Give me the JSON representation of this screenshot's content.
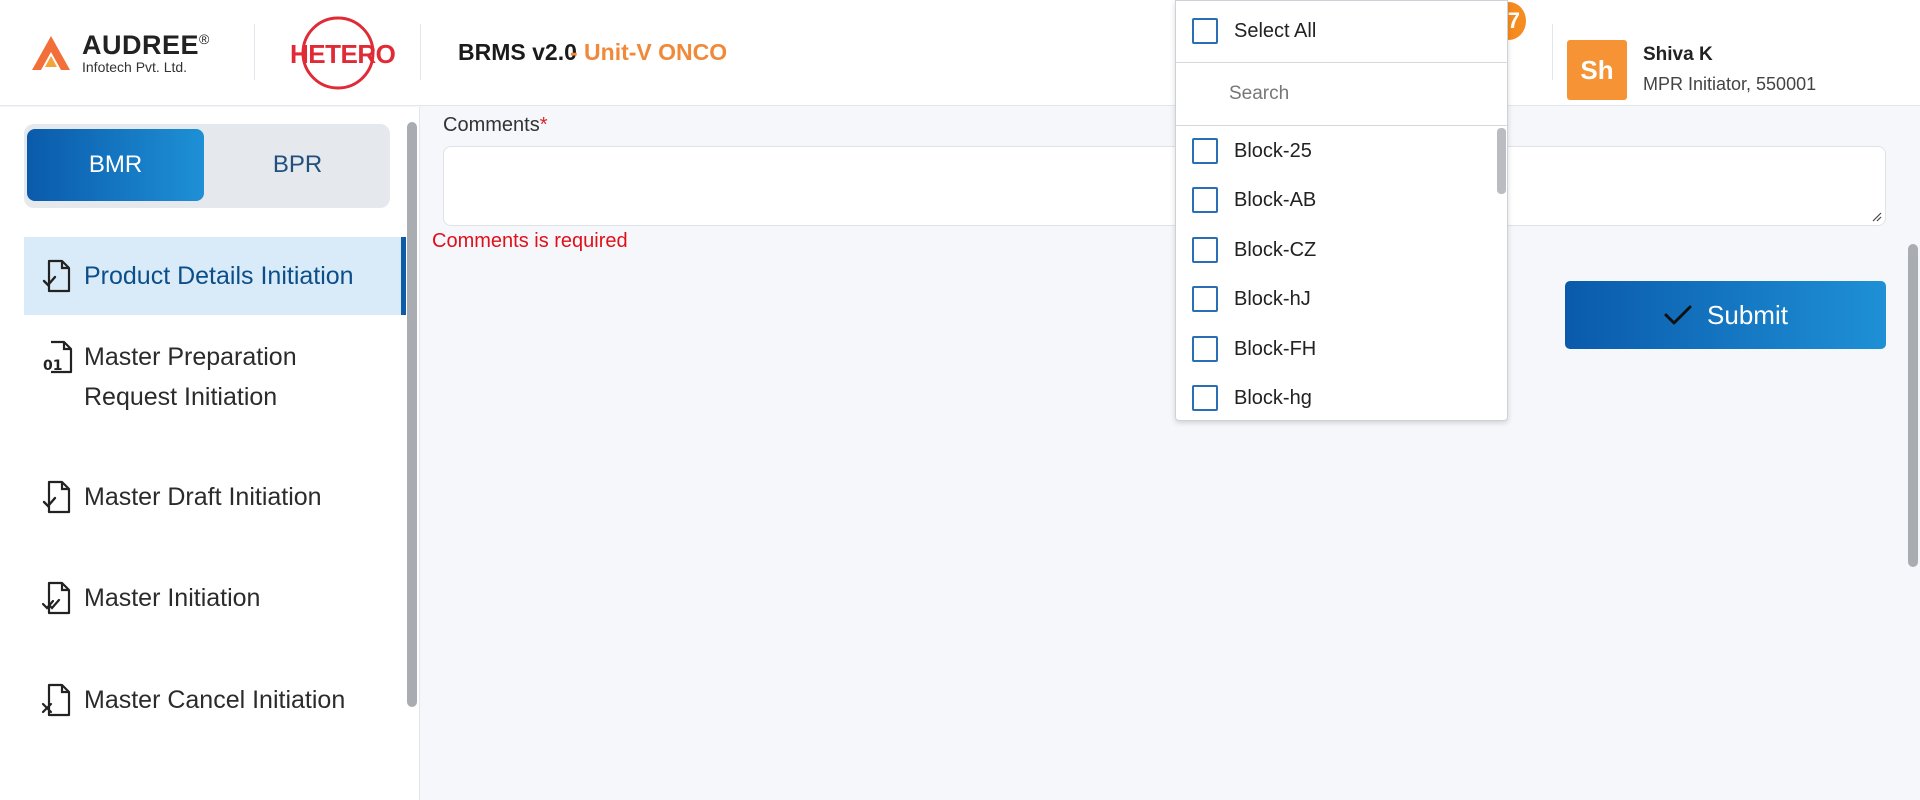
{
  "header": {
    "audree_brand": "AUDREE",
    "audree_registered": "®",
    "audree_sub": "Infotech Pvt. Ltd.",
    "hetero_brand": "HETERO",
    "app_title": "BRMS v2.0",
    "app_unit": "- Unit-V ONCO",
    "notification_count": "7",
    "user": {
      "initials": "Sh",
      "name": "Shiva K",
      "role": "MPR Initiator, 550001"
    }
  },
  "sidebar": {
    "toggle": {
      "active": "BMR",
      "inactive": "BPR"
    },
    "items": [
      {
        "label_line1": "Product Details Initiation",
        "label_line2": ""
      },
      {
        "label_line1": "Master Preparation",
        "label_line2": "Request Initiation"
      },
      {
        "label_line1": "Master Draft Initiation",
        "label_line2": ""
      },
      {
        "label_line1": "Master Initiation",
        "label_line2": ""
      },
      {
        "label_line1": "Master Cancel Initiation",
        "label_line2": ""
      }
    ]
  },
  "form": {
    "comments_label": "Comments",
    "required_marker": "*",
    "comments_value": "",
    "error": "Comments is required",
    "submit_label": "Submit"
  },
  "dropdown": {
    "select_all": "Select All",
    "search_placeholder": "Search",
    "options": [
      "Block-25",
      "Block-AB",
      "Block-CZ",
      "Block-hJ",
      "Block-FH",
      "Block-hg"
    ]
  },
  "colors": {
    "accent": "#0a5aab",
    "brand_orange": "#f68b1f",
    "error": "#e0101b",
    "hetero_red": "#e02b36"
  }
}
